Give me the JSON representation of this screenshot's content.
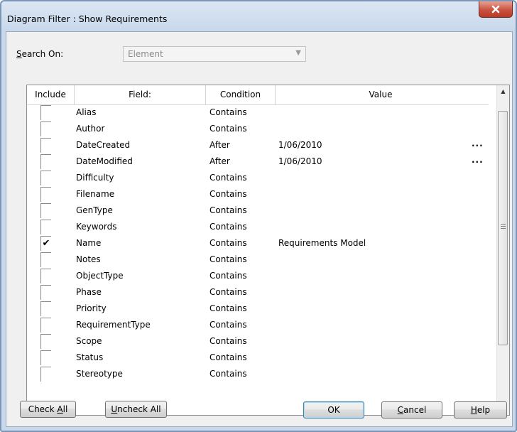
{
  "window": {
    "title": "Diagram Filter : Show Requirements"
  },
  "search": {
    "label_prefix": "S",
    "label_rest": "earch On:",
    "value": "Element"
  },
  "table": {
    "columns": [
      "Include",
      "Field:",
      "Condition",
      "Value"
    ],
    "rows": [
      {
        "checked": false,
        "field": "Alias",
        "condition": "Contains",
        "value": "",
        "ellipsis": ""
      },
      {
        "checked": false,
        "field": "Author",
        "condition": "Contains",
        "value": "",
        "ellipsis": ""
      },
      {
        "checked": false,
        "field": "DateCreated",
        "condition": "After",
        "value": "1/06/2010",
        "ellipsis": "..."
      },
      {
        "checked": false,
        "field": "DateModified",
        "condition": "After",
        "value": "1/06/2010",
        "ellipsis": "..."
      },
      {
        "checked": false,
        "field": "Difficulty",
        "condition": "Contains",
        "value": "",
        "ellipsis": ""
      },
      {
        "checked": false,
        "field": "Filename",
        "condition": "Contains",
        "value": "",
        "ellipsis": ""
      },
      {
        "checked": false,
        "field": "GenType",
        "condition": "Contains",
        "value": "",
        "ellipsis": ""
      },
      {
        "checked": false,
        "field": "Keywords",
        "condition": "Contains",
        "value": "",
        "ellipsis": ""
      },
      {
        "checked": true,
        "field": "Name",
        "condition": "Contains",
        "value": "Requirements Model",
        "ellipsis": ""
      },
      {
        "checked": false,
        "field": "Notes",
        "condition": "Contains",
        "value": "",
        "ellipsis": ""
      },
      {
        "checked": false,
        "field": "ObjectType",
        "condition": "Contains",
        "value": "",
        "ellipsis": ""
      },
      {
        "checked": false,
        "field": "Phase",
        "condition": "Contains",
        "value": "",
        "ellipsis": ""
      },
      {
        "checked": false,
        "field": "Priority",
        "condition": "Contains",
        "value": "",
        "ellipsis": ""
      },
      {
        "checked": false,
        "field": "RequirementType",
        "condition": "Contains",
        "value": "",
        "ellipsis": ""
      },
      {
        "checked": false,
        "field": "Scope",
        "condition": "Contains",
        "value": "",
        "ellipsis": ""
      },
      {
        "checked": false,
        "field": "Status",
        "condition": "Contains",
        "value": "",
        "ellipsis": ""
      },
      {
        "checked": false,
        "field": "Stereotype",
        "condition": "Contains",
        "value": "",
        "ellipsis": ""
      }
    ]
  },
  "buttons": {
    "check_all_prefix": "Check ",
    "check_all_u": "A",
    "check_all_rest": "ll",
    "uncheck_all_u": "U",
    "uncheck_all_rest": "ncheck All",
    "ok": "OK",
    "cancel_u": "C",
    "cancel_rest": "ancel",
    "help_u": "H",
    "help_rest": "elp"
  },
  "colors": {
    "close_button": "#c9513e",
    "title_bar": "#c9d9ec",
    "default_button_border": "#3c7fb1"
  }
}
